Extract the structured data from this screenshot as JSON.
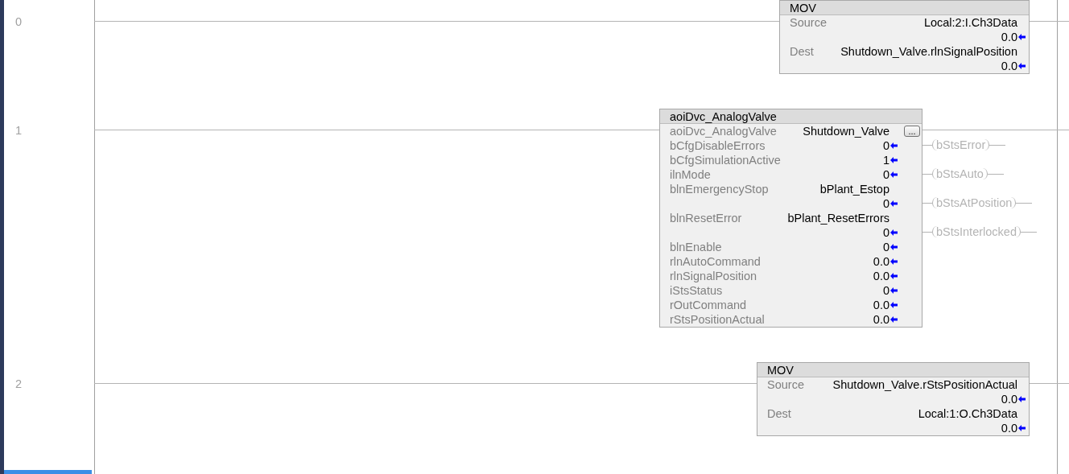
{
  "rungs": [
    {
      "number": "0",
      "instruction": {
        "kind": "mov",
        "name": "MOV",
        "rows": [
          {
            "label": "Source",
            "tag": "Local:2:I.Ch3Data",
            "value": "0.0"
          },
          {
            "label": "Dest",
            "tag": "Shutdown_Valve.rlnSignalPosition",
            "value": "0.0"
          }
        ]
      }
    },
    {
      "number": "1",
      "instruction": {
        "kind": "aoi",
        "name": "aoiDvc_AnalogValve",
        "rows": [
          {
            "label": "aoiDvc_AnalogValve",
            "tag": "Shutdown_Valve",
            "button": "..."
          },
          {
            "label": "bCfgDisableErrors",
            "value": "0",
            "coil": "bStsError"
          },
          {
            "label": "bCfgSimulationActive",
            "value": "1"
          },
          {
            "label": "ilnMode",
            "value": "0",
            "coil": "bStsAuto"
          },
          {
            "label": "blnEmergencyStop",
            "tag": "bPlant_Estop",
            "value": "0",
            "coil": "bStsAtPosition"
          },
          {
            "label": "blnResetError",
            "tag": "bPlant_ResetErrors",
            "value": "0",
            "coil": "bStsInterlocked"
          },
          {
            "label": "blnEnable",
            "value": "0"
          },
          {
            "label": "rlnAutoCommand",
            "value": "0.0"
          },
          {
            "label": "rlnSignalPosition",
            "value": "0.0"
          },
          {
            "label": "iStsStatus",
            "value": "0"
          },
          {
            "label": "rOutCommand",
            "value": "0.0"
          },
          {
            "label": "rStsPositionActual",
            "value": "0.0"
          }
        ]
      }
    },
    {
      "number": "2",
      "instruction": {
        "kind": "mov",
        "name": "MOV",
        "rows": [
          {
            "label": "Source",
            "tag": "Shutdown_Valve.rStsPositionActual",
            "value": "0.0"
          },
          {
            "label": "Dest",
            "tag": "Local:1:O.Ch3Data",
            "value": "0.0"
          }
        ]
      }
    }
  ]
}
